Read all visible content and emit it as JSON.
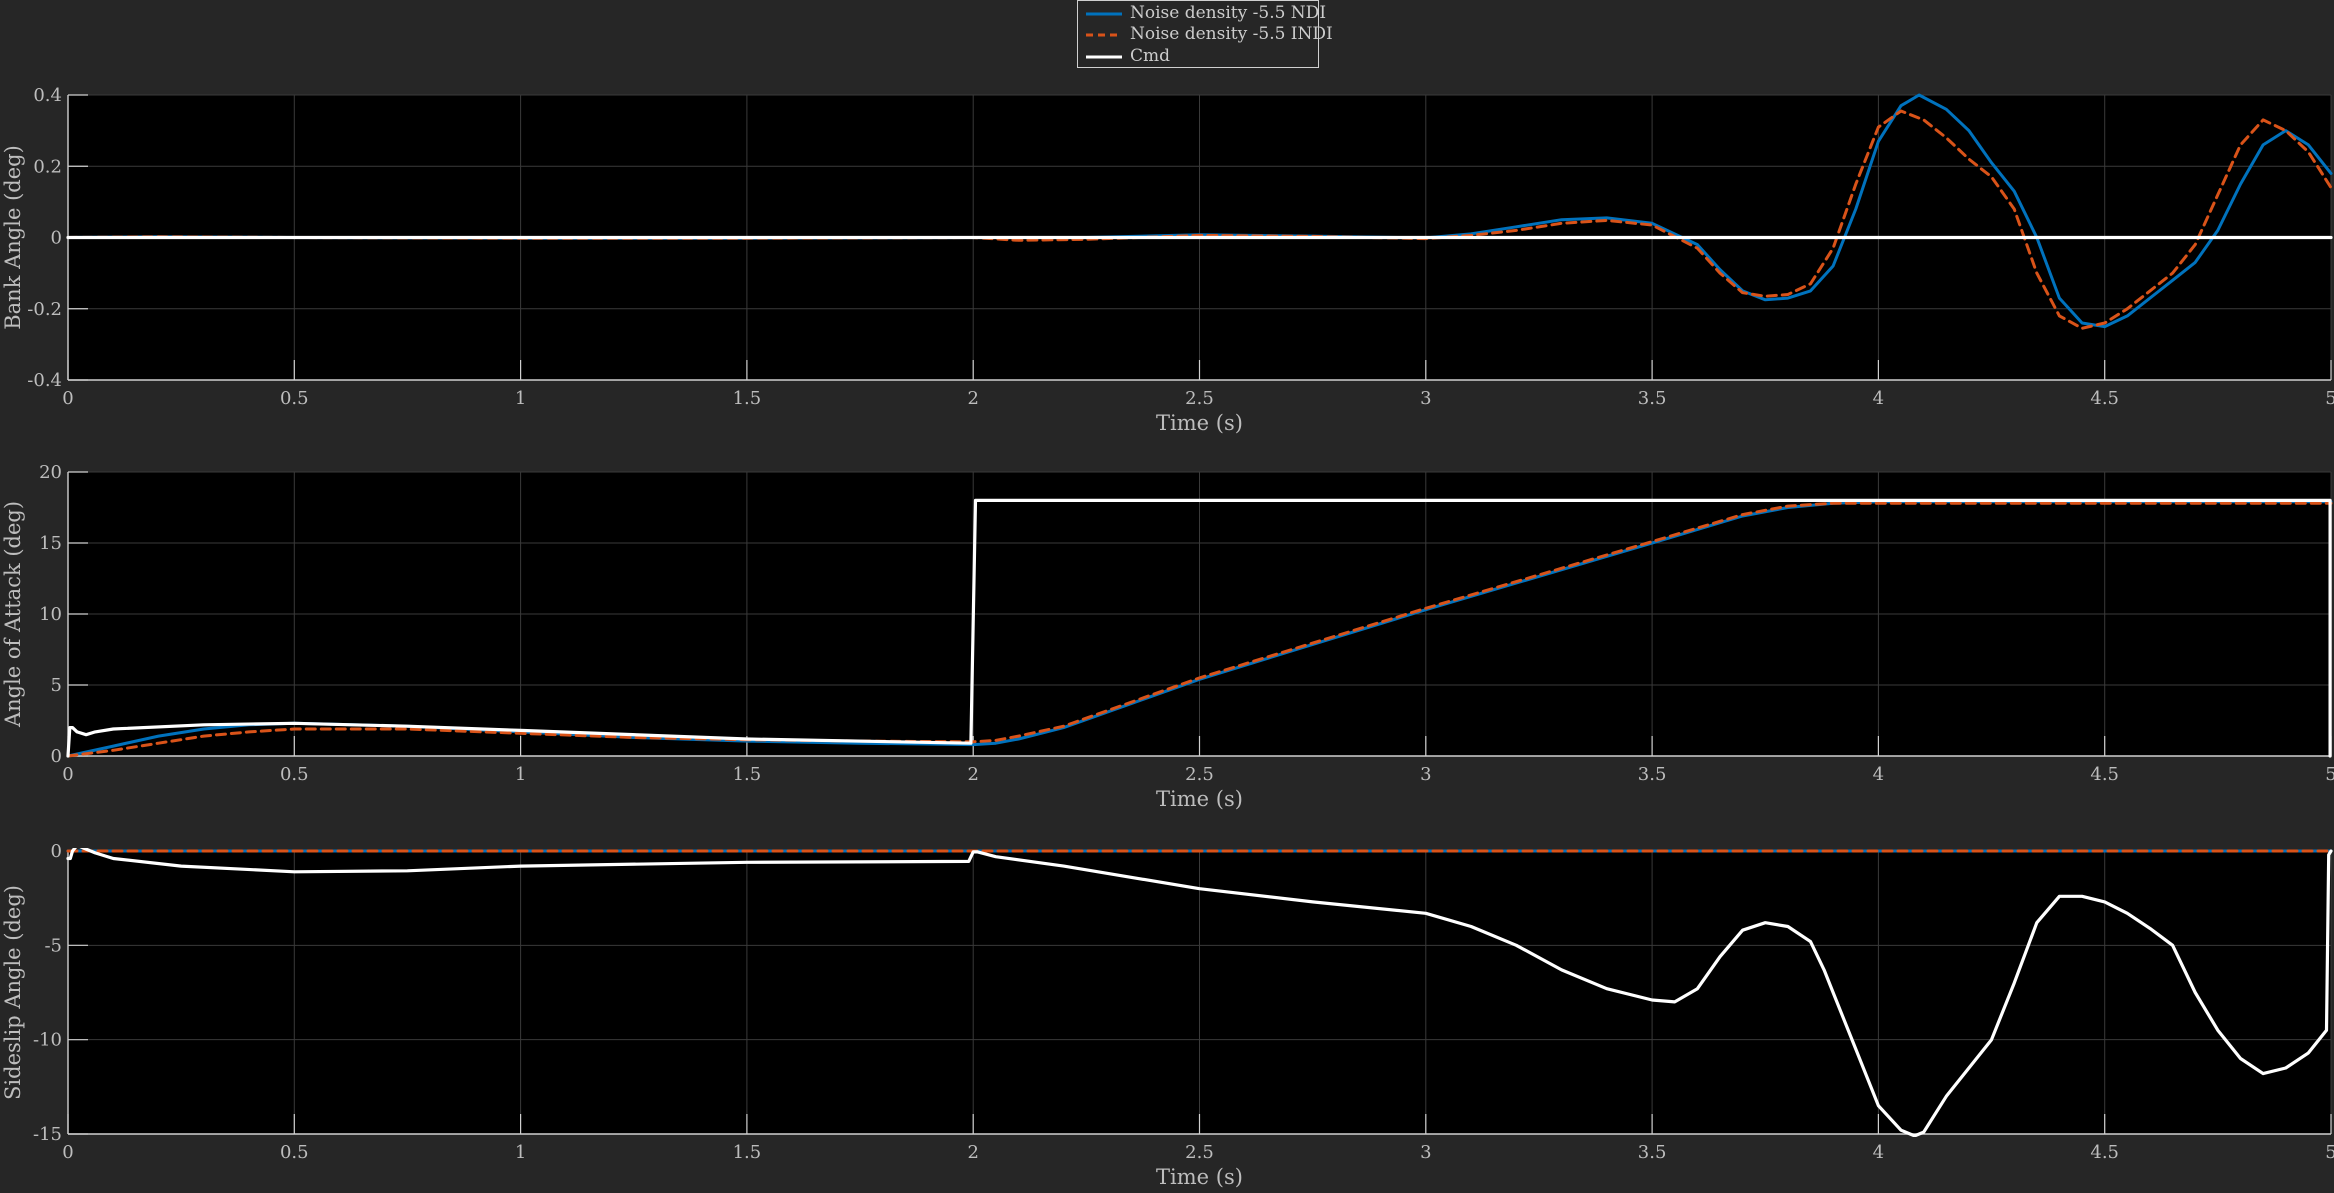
{
  "legend": {
    "entries": [
      {
        "label": "Noise density -5.5 NDI",
        "color": "#0072BD",
        "dash": "solid"
      },
      {
        "label": "Noise density -5.5 INDI",
        "color": "#D95319",
        "dash": "dashed"
      },
      {
        "label": "Cmd",
        "color": "#FFFFFF",
        "dash": "solid"
      }
    ]
  },
  "theme": {
    "figure_bg": "#262626",
    "axes_bg": "#000000",
    "grid": "#3a3a3a",
    "axis_text": "#bdbdbd",
    "ndi_color": "#0072BD",
    "indi_color": "#D95319",
    "cmd_color": "#FFFFFF"
  },
  "chart_data": [
    {
      "type": "line",
      "xlabel": "Time (s)",
      "ylabel": "Bank Angle (deg)",
      "xlim": [
        0,
        5
      ],
      "ylim": [
        -0.4,
        0.4
      ],
      "xticks": [
        "0",
        "0.5",
        "1",
        "1.5",
        "2",
        "2.5",
        "3",
        "3.5",
        "4",
        "4.5",
        "5"
      ],
      "yticks": [
        "-0.4",
        "-0.2",
        "0",
        "0.2",
        "0.4"
      ],
      "ytick_values": [
        -0.4,
        -0.2,
        0,
        0.2,
        0.4
      ],
      "grid": true,
      "series": [
        {
          "name": "Noise density -5.5 NDI",
          "key": "ndi",
          "x": [
            0,
            0.2,
            0.5,
            1,
            1.5,
            2,
            2.25,
            2.5,
            2.75,
            3,
            3.1,
            3.2,
            3.3,
            3.4,
            3.5,
            3.6,
            3.65,
            3.7,
            3.75,
            3.8,
            3.85,
            3.9,
            3.95,
            4.0,
            4.05,
            4.09,
            4.15,
            4.2,
            4.25,
            4.3,
            4.35,
            4.4,
            4.45,
            4.5,
            4.55,
            4.6,
            4.65,
            4.7,
            4.75,
            4.8,
            4.85,
            4.9,
            4.95,
            5.0
          ],
          "y": [
            0.0,
            0.002,
            0.0,
            -0.002,
            -0.002,
            0.0,
            0.0,
            0.008,
            0.004,
            -0.001,
            0.01,
            0.03,
            0.05,
            0.055,
            0.04,
            -0.02,
            -0.09,
            -0.15,
            -0.175,
            -0.17,
            -0.15,
            -0.08,
            0.08,
            0.27,
            0.37,
            0.4,
            0.36,
            0.3,
            0.21,
            0.13,
            0.0,
            -0.17,
            -0.24,
            -0.25,
            -0.22,
            -0.17,
            -0.12,
            -0.07,
            0.02,
            0.15,
            0.26,
            0.3,
            0.26,
            0.18
          ]
        },
        {
          "name": "Noise density -5.5 INDI",
          "key": "indi",
          "x": [
            0,
            0.2,
            0.5,
            1,
            1.5,
            2,
            2.1,
            2.25,
            2.5,
            2.75,
            3,
            3.1,
            3.2,
            3.3,
            3.4,
            3.5,
            3.6,
            3.65,
            3.7,
            3.75,
            3.8,
            3.85,
            3.9,
            3.95,
            4.0,
            4.05,
            4.1,
            4.15,
            4.2,
            4.25,
            4.3,
            4.35,
            4.4,
            4.45,
            4.5,
            4.55,
            4.6,
            4.65,
            4.7,
            4.75,
            4.8,
            4.85,
            4.9,
            4.95,
            5.0
          ],
          "y": [
            0.0,
            0.002,
            0.0,
            -0.002,
            -0.002,
            0.0,
            -0.008,
            -0.005,
            0.006,
            0.003,
            -0.003,
            0.006,
            0.02,
            0.04,
            0.048,
            0.035,
            -0.03,
            -0.1,
            -0.155,
            -0.165,
            -0.16,
            -0.13,
            -0.03,
            0.15,
            0.31,
            0.355,
            0.33,
            0.28,
            0.22,
            0.17,
            0.08,
            -0.1,
            -0.22,
            -0.255,
            -0.24,
            -0.2,
            -0.15,
            -0.1,
            -0.02,
            0.12,
            0.26,
            0.33,
            0.3,
            0.24,
            0.14
          ]
        },
        {
          "name": "Cmd",
          "key": "cmd",
          "x": [
            0,
            5
          ],
          "y": [
            0,
            0
          ]
        }
      ]
    },
    {
      "type": "line",
      "xlabel": "Time (s)",
      "ylabel": "Angle of Attack (deg)",
      "xlim": [
        0,
        5
      ],
      "ylim": [
        0,
        20
      ],
      "xticks": [
        "0",
        "0.5",
        "1",
        "1.5",
        "2",
        "2.5",
        "3",
        "3.5",
        "4",
        "4.5",
        "5"
      ],
      "yticks": [
        "0",
        "5",
        "10",
        "15",
        "20"
      ],
      "ytick_values": [
        0,
        5,
        10,
        15,
        20
      ],
      "grid": true,
      "series": [
        {
          "name": "Noise density -5.5 NDI",
          "key": "ndi",
          "x": [
            0,
            0.1,
            0.2,
            0.3,
            0.4,
            0.5,
            0.75,
            1.0,
            1.25,
            1.5,
            1.75,
            2.0,
            2.05,
            2.1,
            2.2,
            2.5,
            3.0,
            3.5,
            3.7,
            3.8,
            3.9,
            4.0,
            4.5,
            4.9,
            5.0
          ],
          "y": [
            0.0,
            0.7,
            1.4,
            1.9,
            2.2,
            2.3,
            2.1,
            1.7,
            1.3,
            1.05,
            0.9,
            0.8,
            0.9,
            1.2,
            2.0,
            5.4,
            10.3,
            15.0,
            16.9,
            17.5,
            17.8,
            17.9,
            17.9,
            17.9,
            17.9
          ]
        },
        {
          "name": "Noise density -5.5 INDI",
          "key": "indi",
          "x": [
            0,
            0.1,
            0.2,
            0.3,
            0.4,
            0.5,
            0.75,
            1.0,
            1.25,
            1.5,
            1.75,
            2.0,
            2.05,
            2.1,
            2.2,
            2.5,
            3.0,
            3.5,
            3.7,
            3.8,
            3.9,
            4.0,
            4.5,
            4.9,
            5.0
          ],
          "y": [
            0.0,
            0.4,
            0.9,
            1.4,
            1.7,
            1.9,
            1.9,
            1.6,
            1.3,
            1.15,
            1.05,
            1.0,
            1.1,
            1.4,
            2.1,
            5.5,
            10.4,
            15.1,
            17.0,
            17.6,
            17.8,
            17.8,
            17.8,
            17.8,
            17.8
          ]
        },
        {
          "name": "Cmd",
          "key": "cmd",
          "x": [
            0,
            0.004,
            0.01,
            0.02,
            0.04,
            0.06,
            0.1,
            0.3,
            0.5,
            0.75,
            1.0,
            1.5,
            1.995,
            1.995,
            2.005,
            2.005,
            3.0,
            4.0,
            4.998,
            4.998
          ],
          "y": [
            0,
            2.0,
            2.0,
            1.7,
            1.5,
            1.7,
            1.9,
            2.2,
            2.3,
            2.1,
            1.8,
            1.2,
            0.9,
            0.9,
            18.0,
            18.0,
            18.0,
            18.0,
            18.0,
            0
          ]
        }
      ]
    },
    {
      "type": "line",
      "xlabel": "Time (s)",
      "ylabel": "Sideslip Angle (deg)",
      "xlim": [
        0,
        5
      ],
      "ylim": [
        -15,
        0
      ],
      "xticks": [
        "0",
        "0.5",
        "1",
        "1.5",
        "2",
        "2.5",
        "3",
        "3.5",
        "4",
        "4.5",
        "5"
      ],
      "yticks": [
        "-15",
        "-10",
        "-5",
        "0"
      ],
      "ytick_values": [
        -15,
        -10,
        -5,
        0
      ],
      "grid": true,
      "series": [
        {
          "name": "Noise density -5.5 NDI",
          "key": "ndi",
          "x": [
            0,
            5
          ],
          "y": [
            0,
            0
          ]
        },
        {
          "name": "Noise density -5.5 INDI",
          "key": "indi",
          "x": [
            0,
            5
          ],
          "y": [
            0,
            0
          ]
        },
        {
          "name": "Cmd",
          "key": "cmd",
          "x": [
            0,
            0.005,
            0.01,
            0.02,
            0.04,
            0.06,
            0.1,
            0.25,
            0.5,
            0.75,
            1.0,
            1.5,
            1.99,
            2.0,
            2.01,
            2.05,
            2.2,
            2.5,
            2.75,
            3.0,
            3.1,
            3.2,
            3.3,
            3.4,
            3.5,
            3.55,
            3.6,
            3.65,
            3.7,
            3.75,
            3.8,
            3.85,
            3.88,
            3.9,
            3.95,
            4.0,
            4.05,
            4.08,
            4.1,
            4.15,
            4.2,
            4.25,
            4.3,
            4.35,
            4.4,
            4.45,
            4.5,
            4.55,
            4.6,
            4.65,
            4.7,
            4.75,
            4.8,
            4.85,
            4.9,
            4.95,
            4.99,
            4.995,
            5.0
          ],
          "y": [
            -0.4,
            -0.4,
            0.0,
            0.3,
            0.1,
            -0.1,
            -0.4,
            -0.8,
            -1.1,
            -1.05,
            -0.8,
            -0.6,
            -0.55,
            -0.05,
            -0.05,
            -0.3,
            -0.8,
            -2.0,
            -2.7,
            -3.3,
            -4.0,
            -5.0,
            -6.3,
            -7.3,
            -7.9,
            -8.0,
            -7.3,
            -5.6,
            -4.2,
            -3.8,
            -4.0,
            -4.8,
            -6.3,
            -7.5,
            -10.5,
            -13.5,
            -14.8,
            -15.1,
            -14.9,
            -13.0,
            -11.5,
            -10.0,
            -7.0,
            -3.8,
            -2.4,
            -2.4,
            -2.7,
            -3.3,
            -4.1,
            -5.0,
            -7.5,
            -9.5,
            -11.0,
            -11.8,
            -11.5,
            -10.7,
            -9.5,
            -0.2,
            0.0
          ]
        }
      ]
    }
  ]
}
